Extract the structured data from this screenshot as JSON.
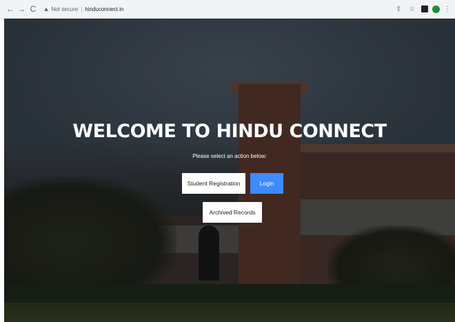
{
  "browser": {
    "security_label": "Not secure",
    "url": "hinduconnect.in",
    "icons": [
      "back-arrow-icon",
      "forward-arrow-icon",
      "reload-icon",
      "warning-icon",
      "share-icon",
      "star-icon",
      "sidepanel-icon",
      "avatar-icon",
      "kebab-menu-icon"
    ]
  },
  "hero": {
    "title": "WELCOME TO HINDU CONNECT",
    "subtitle": "Please select an action below:"
  },
  "actions": {
    "student_registration": "Student Registration",
    "login": "Login",
    "archived_records": "Archived Records"
  },
  "colors": {
    "login_button": "#3d8bfd",
    "button_white": "#ffffff",
    "title_text": "#ffffff"
  }
}
